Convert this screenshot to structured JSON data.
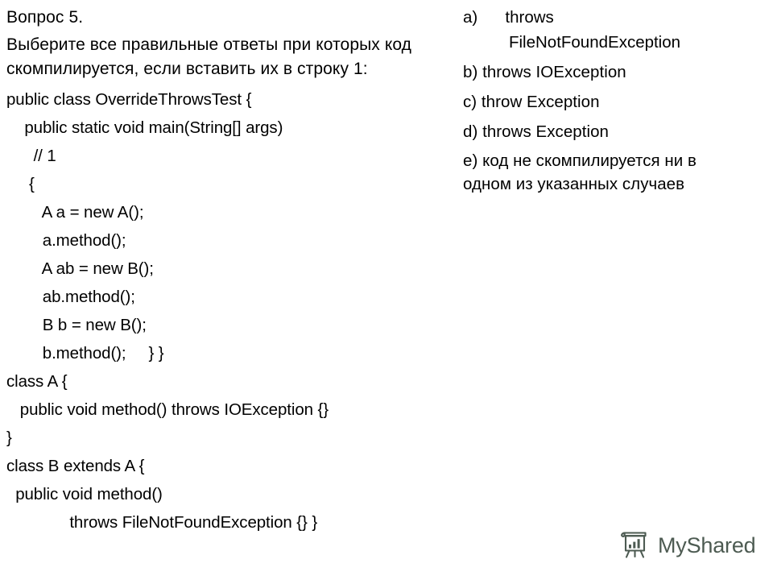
{
  "question": {
    "number_label": "Вопрос 5.",
    "prompt": "Выберите все правильные ответы при которых код скомпилируется, если вставить их в строку 1:"
  },
  "code": {
    "lines": [
      "public class OverrideThrowsTest {",
      "    public static void main(String[] args)",
      "      // 1",
      "     {",
      "        A a = new A();",
      "        a.method();",
      "        A ab = new B();",
      "        ab.method();",
      "        B b = new B();",
      "        b.method();     } }",
      "class A {",
      "   public void method() throws IOException {}",
      "}",
      "class B extends A {",
      "  public void method()",
      "              throws FileNotFoundException {} }"
    ]
  },
  "answers": {
    "option_a": {
      "marker": "a)",
      "line1": "a)      throws",
      "line2": "          FileNotFoundException"
    },
    "option_b": "b) throws IOException",
    "option_c": "c) throw Exception",
    "option_d": "d) throws Exception",
    "option_e": "e) код не скомпилируется ни в одном из указанных случаев"
  },
  "watermark": {
    "brand": "MyShared",
    "icon": "flipchart-presentation-icon",
    "color": "#4d5b52"
  },
  "colors": {
    "background": "#ffffff",
    "text": "#000000",
    "watermark": "#4d5b52"
  }
}
